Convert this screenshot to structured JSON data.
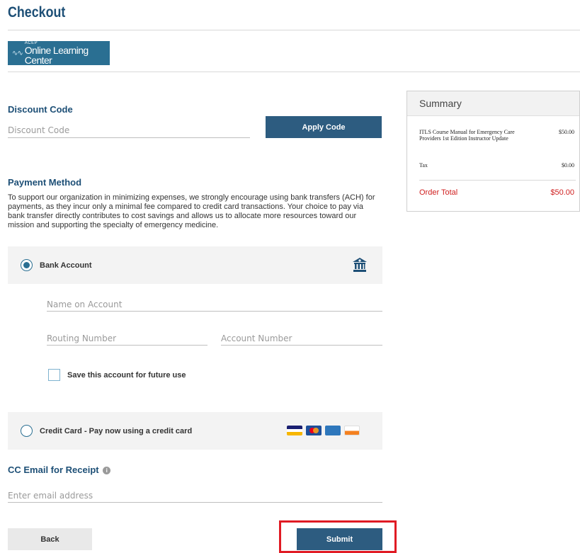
{
  "page": {
    "title": "Checkout"
  },
  "logo": {
    "small": "ACEP",
    "big": "Online Learning Center"
  },
  "discount": {
    "heading": "Discount Code",
    "placeholder": "Discount Code",
    "button_label": "Apply Code"
  },
  "payment": {
    "heading": "Payment Method",
    "description": "To support our organization in minimizing expenses, we strongly encourage using bank transfers (ACH) for payments, as they incur only a minimal fee compared to credit card transactions. Your choice to pay via bank transfer directly contributes to cost savings and allows us to allocate more resources toward our mission and supporting the specialty of emergency medicine.",
    "bank": {
      "label": "Bank Account",
      "selected": true,
      "icon": "bank-icon",
      "name_placeholder": "Name on Account",
      "routing_placeholder": "Routing Number",
      "account_placeholder": "Account Number",
      "save_label": "Save this account for future use",
      "save_checked": false
    },
    "card": {
      "label": "Credit Card - Pay now using a credit card",
      "selected": false,
      "icons": [
        "visa-icon",
        "mastercard-icon",
        "amex-icon",
        "discover-icon"
      ]
    }
  },
  "cc_email": {
    "heading": "CC Email for Receipt",
    "info_icon": "info-icon",
    "placeholder": "Enter email address"
  },
  "actions": {
    "back_label": "Back",
    "submit_label": "Submit"
  },
  "summary": {
    "heading": "Summary",
    "items": [
      {
        "name": "ITLS Course Manual for Emergency Care Providers 1st Edition Instructor Update",
        "price": "$50.00"
      }
    ],
    "tax_label": "Tax",
    "tax": "$0.00",
    "total_label": "Order Total",
    "total": "$50.00"
  },
  "colors": {
    "brand": "#1d4f76",
    "button": "#2d5c80",
    "highlight": "#e01b24",
    "total": "#d02020"
  }
}
